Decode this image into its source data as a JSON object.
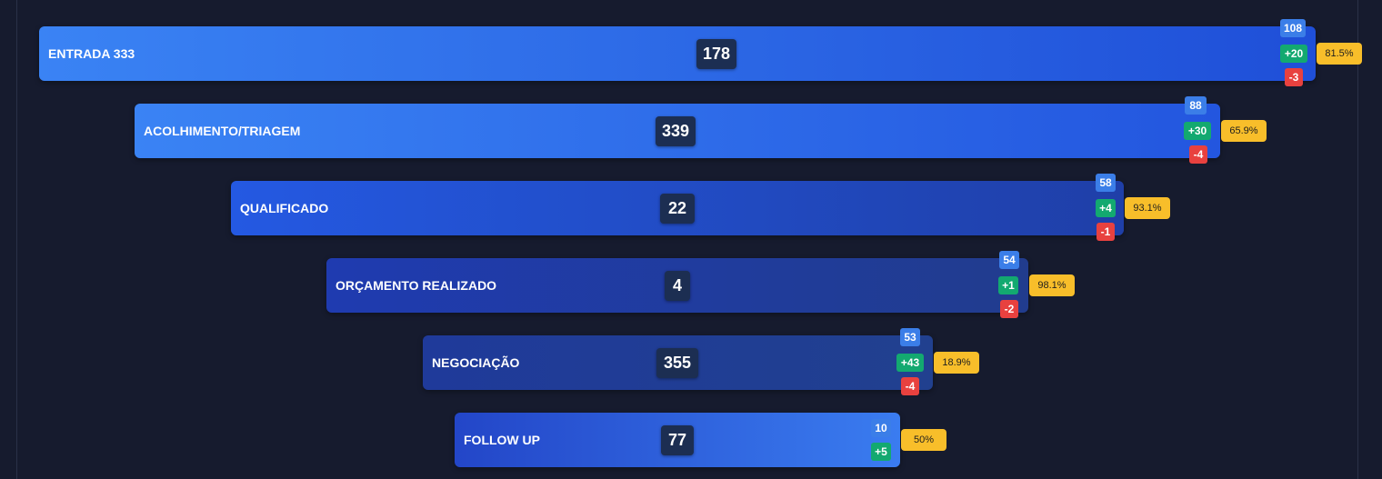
{
  "funnel": {
    "stages": [
      {
        "label": "ENTRADA 333",
        "count": "178",
        "total": "108",
        "in": "+20",
        "out": "-3",
        "rate": "81.5%"
      },
      {
        "label": "ACOLHIMENTO/TRIAGEM",
        "count": "339",
        "total": "88",
        "in": "+30",
        "out": "-4",
        "rate": "65.9%"
      },
      {
        "label": "QUALIFICADO",
        "count": "22",
        "total": "58",
        "in": "+4",
        "out": "-1",
        "rate": "93.1%"
      },
      {
        "label": "ORÇAMENTO REALIZADO",
        "count": "4",
        "total": "54",
        "in": "+1",
        "out": "-2",
        "rate": "98.1%"
      },
      {
        "label": "NEGOCIAÇÃO",
        "count": "355",
        "total": "53",
        "in": "+43",
        "out": "-4",
        "rate": "18.9%"
      },
      {
        "label": "FOLLOW UP",
        "count": "77",
        "total": "10",
        "in": "+5",
        "rate": "50%"
      }
    ]
  },
  "colors": {
    "background": "#161b2e",
    "stage_gradients": [
      [
        "#3a83f4",
        "#1f4fd8"
      ],
      [
        "#3a83f4",
        "#2356df"
      ],
      [
        "#2459e2",
        "#1f3fa8"
      ],
      [
        "#1f3bb0",
        "#213c8e"
      ],
      [
        "#1f3a9a",
        "#21408f"
      ],
      [
        "#2346c8",
        "#3a7cf0"
      ]
    ],
    "badge_total": "#3b7ee8",
    "badge_in": "#13a970",
    "badge_out": "#e8413f",
    "badge_rate": "#f8be2a",
    "count_box": "#1c2e52"
  }
}
